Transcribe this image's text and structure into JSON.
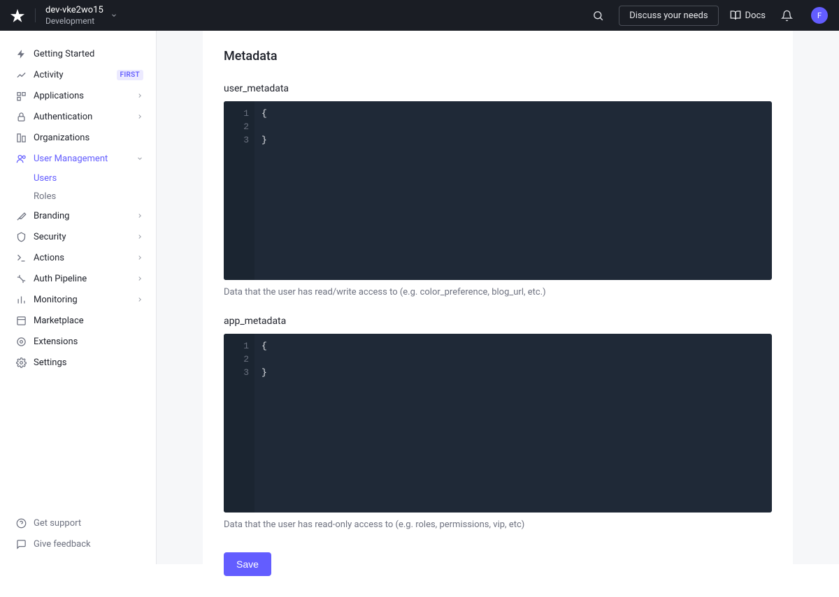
{
  "header": {
    "tenant_name": "dev-vke2wo15",
    "tenant_env": "Development",
    "discuss_label": "Discuss your needs",
    "docs_label": "Docs",
    "avatar_letter": "F"
  },
  "sidebar": {
    "items": [
      {
        "label": "Getting Started",
        "expandable": false
      },
      {
        "label": "Activity",
        "expandable": false,
        "badge": "FIRST"
      },
      {
        "label": "Applications",
        "expandable": true
      },
      {
        "label": "Authentication",
        "expandable": true
      },
      {
        "label": "Organizations",
        "expandable": false
      },
      {
        "label": "User Management",
        "expandable": true,
        "active": true
      },
      {
        "label": "Branding",
        "expandable": true
      },
      {
        "label": "Security",
        "expandable": true
      },
      {
        "label": "Actions",
        "expandable": true
      },
      {
        "label": "Auth Pipeline",
        "expandable": true
      },
      {
        "label": "Monitoring",
        "expandable": true
      },
      {
        "label": "Marketplace",
        "expandable": false
      },
      {
        "label": "Extensions",
        "expandable": false
      },
      {
        "label": "Settings",
        "expandable": false
      }
    ],
    "sub_user_management": [
      {
        "label": "Users",
        "active": true
      },
      {
        "label": "Roles",
        "active": false
      }
    ],
    "footer": [
      {
        "label": "Get support"
      },
      {
        "label": "Give feedback"
      }
    ]
  },
  "main": {
    "section_title": "Metadata",
    "user_metadata": {
      "label": "user_metadata",
      "lines": [
        "{",
        "",
        "}"
      ],
      "help": "Data that the user has read/write access to (e.g. color_preference, blog_url, etc.)"
    },
    "app_metadata": {
      "label": "app_metadata",
      "lines": [
        "{",
        "",
        "}"
      ],
      "help": "Data that the user has read-only access to (e.g. roles, permissions, vip, etc)"
    },
    "save_label": "Save"
  }
}
